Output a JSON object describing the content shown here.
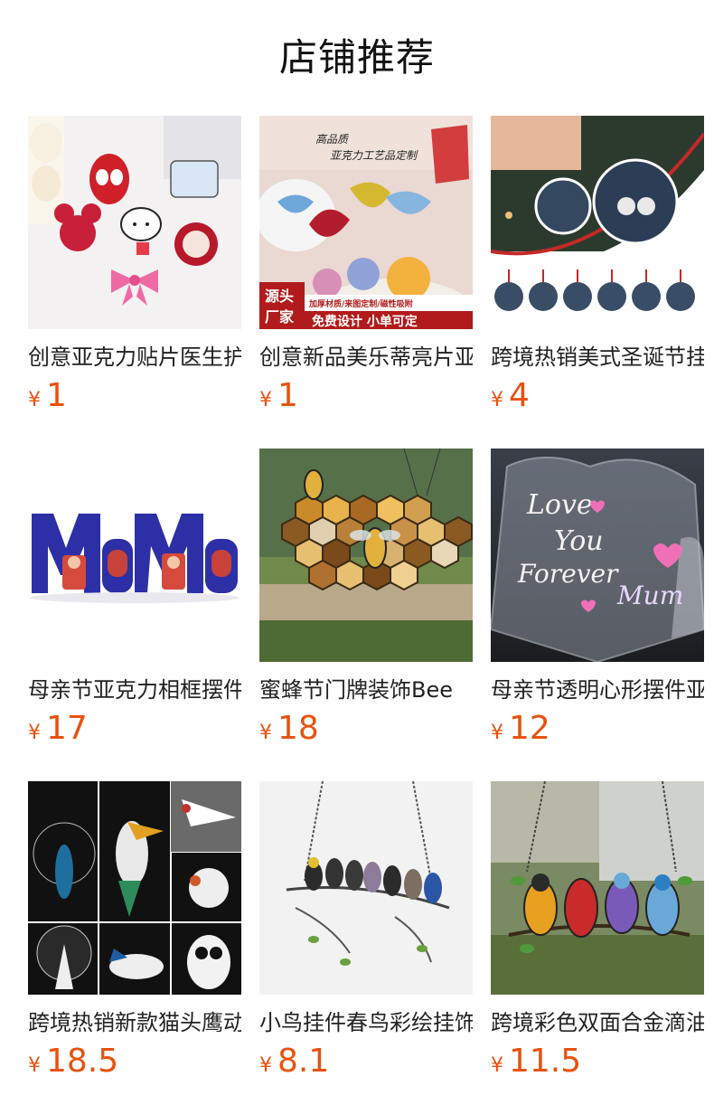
{
  "page": {
    "title": "店铺推荐",
    "accent_color": "#e8520f"
  },
  "products": [
    {
      "name": "创意亚克力贴片医生护士",
      "currency": "¥",
      "price": "1",
      "image": "acrylic-cartoon-patches"
    },
    {
      "name": "创意新品美乐蒂亮片亚克力",
      "currency": "¥",
      "price": "1",
      "image": "glitter-acrylic-charms",
      "image_text": [
        "高品质",
        "亚克力工艺品定制",
        "源头",
        "厂家",
        "加厚材质/来图定制/磁性吸附",
        "免费设计 小单可定"
      ]
    },
    {
      "name": "跨境热销美式圣诞节挂件",
      "currency": "¥",
      "price": "4",
      "image": "christmas-round-ornaments"
    },
    {
      "name": "母亲节亚克力相框摆件",
      "currency": "¥",
      "price": "17",
      "image": "mama-photo-frame"
    },
    {
      "name": "蜜蜂节门牌装饰Bee",
      "currency": "¥",
      "price": "18",
      "image": "bee-honeycomb-suncatcher"
    },
    {
      "name": "母亲节透明心形摆件亚克力",
      "currency": "¥",
      "price": "12",
      "image": "clear-heart-love-mum",
      "image_text": [
        "Love",
        "You",
        "Forever",
        "Mum"
      ]
    },
    {
      "name": "跨境热销新款猫头鹰动物",
      "currency": "¥",
      "price": "18.5",
      "image": "animal-silhouette-ornaments"
    },
    {
      "name": "小鸟挂件春鸟彩绘挂饰",
      "currency": "¥",
      "price": "8.1",
      "image": "birds-on-branch-hanger"
    },
    {
      "name": "跨境彩色双面合金滴油挂件",
      "currency": "¥",
      "price": "11.5",
      "image": "stained-glass-birds"
    }
  ]
}
